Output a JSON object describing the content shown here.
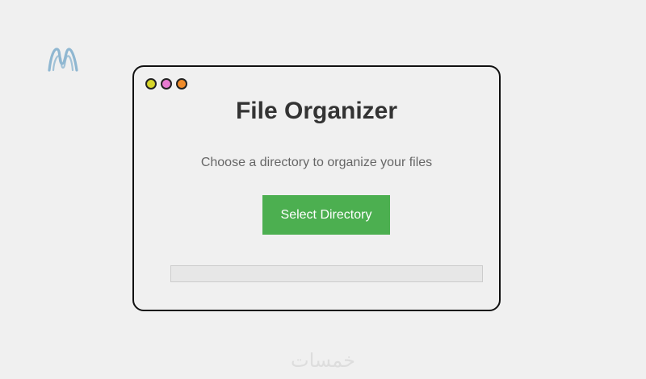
{
  "brand": {
    "logo_icon": "m-logo-icon",
    "logo_color": "#8fb7d1"
  },
  "window": {
    "controls": [
      {
        "name": "close-dot",
        "color": "#d7d52a"
      },
      {
        "name": "minimize-dot",
        "color": "#e77ad0"
      },
      {
        "name": "maximize-dot",
        "color": "#ef8b2a"
      }
    ]
  },
  "main": {
    "title": "File Organizer",
    "subtitle": "Choose a directory to organize your files",
    "select_button_label": "Select Directory",
    "progress_value": 0
  },
  "watermark": {
    "text": "خمسات"
  },
  "colors": {
    "accent": "#4caf50",
    "background": "#f0f0f0",
    "border": "#111111"
  }
}
